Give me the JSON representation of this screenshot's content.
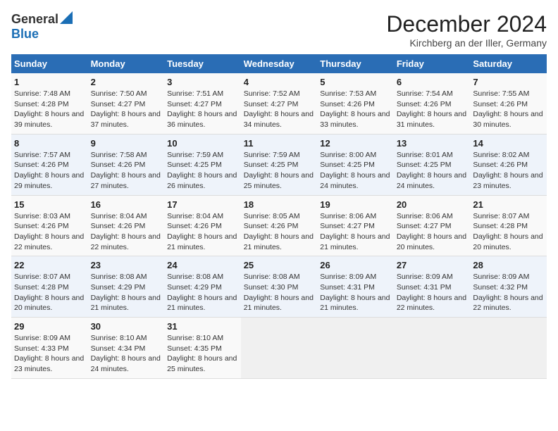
{
  "header": {
    "logo_general": "General",
    "logo_blue": "Blue",
    "month_title": "December 2024",
    "location": "Kirchberg an der Iller, Germany"
  },
  "weekdays": [
    "Sunday",
    "Monday",
    "Tuesday",
    "Wednesday",
    "Thursday",
    "Friday",
    "Saturday"
  ],
  "weeks": [
    [
      {
        "day": "1",
        "sunrise": "Sunrise: 7:48 AM",
        "sunset": "Sunset: 4:28 PM",
        "daylight": "Daylight: 8 hours and 39 minutes."
      },
      {
        "day": "2",
        "sunrise": "Sunrise: 7:50 AM",
        "sunset": "Sunset: 4:27 PM",
        "daylight": "Daylight: 8 hours and 37 minutes."
      },
      {
        "day": "3",
        "sunrise": "Sunrise: 7:51 AM",
        "sunset": "Sunset: 4:27 PM",
        "daylight": "Daylight: 8 hours and 36 minutes."
      },
      {
        "day": "4",
        "sunrise": "Sunrise: 7:52 AM",
        "sunset": "Sunset: 4:27 PM",
        "daylight": "Daylight: 8 hours and 34 minutes."
      },
      {
        "day": "5",
        "sunrise": "Sunrise: 7:53 AM",
        "sunset": "Sunset: 4:26 PM",
        "daylight": "Daylight: 8 hours and 33 minutes."
      },
      {
        "day": "6",
        "sunrise": "Sunrise: 7:54 AM",
        "sunset": "Sunset: 4:26 PM",
        "daylight": "Daylight: 8 hours and 31 minutes."
      },
      {
        "day": "7",
        "sunrise": "Sunrise: 7:55 AM",
        "sunset": "Sunset: 4:26 PM",
        "daylight": "Daylight: 8 hours and 30 minutes."
      }
    ],
    [
      {
        "day": "8",
        "sunrise": "Sunrise: 7:57 AM",
        "sunset": "Sunset: 4:26 PM",
        "daylight": "Daylight: 8 hours and 29 minutes."
      },
      {
        "day": "9",
        "sunrise": "Sunrise: 7:58 AM",
        "sunset": "Sunset: 4:26 PM",
        "daylight": "Daylight: 8 hours and 27 minutes."
      },
      {
        "day": "10",
        "sunrise": "Sunrise: 7:59 AM",
        "sunset": "Sunset: 4:25 PM",
        "daylight": "Daylight: 8 hours and 26 minutes."
      },
      {
        "day": "11",
        "sunrise": "Sunrise: 7:59 AM",
        "sunset": "Sunset: 4:25 PM",
        "daylight": "Daylight: 8 hours and 25 minutes."
      },
      {
        "day": "12",
        "sunrise": "Sunrise: 8:00 AM",
        "sunset": "Sunset: 4:25 PM",
        "daylight": "Daylight: 8 hours and 24 minutes."
      },
      {
        "day": "13",
        "sunrise": "Sunrise: 8:01 AM",
        "sunset": "Sunset: 4:25 PM",
        "daylight": "Daylight: 8 hours and 24 minutes."
      },
      {
        "day": "14",
        "sunrise": "Sunrise: 8:02 AM",
        "sunset": "Sunset: 4:26 PM",
        "daylight": "Daylight: 8 hours and 23 minutes."
      }
    ],
    [
      {
        "day": "15",
        "sunrise": "Sunrise: 8:03 AM",
        "sunset": "Sunset: 4:26 PM",
        "daylight": "Daylight: 8 hours and 22 minutes."
      },
      {
        "day": "16",
        "sunrise": "Sunrise: 8:04 AM",
        "sunset": "Sunset: 4:26 PM",
        "daylight": "Daylight: 8 hours and 22 minutes."
      },
      {
        "day": "17",
        "sunrise": "Sunrise: 8:04 AM",
        "sunset": "Sunset: 4:26 PM",
        "daylight": "Daylight: 8 hours and 21 minutes."
      },
      {
        "day": "18",
        "sunrise": "Sunrise: 8:05 AM",
        "sunset": "Sunset: 4:26 PM",
        "daylight": "Daylight: 8 hours and 21 minutes."
      },
      {
        "day": "19",
        "sunrise": "Sunrise: 8:06 AM",
        "sunset": "Sunset: 4:27 PM",
        "daylight": "Daylight: 8 hours and 21 minutes."
      },
      {
        "day": "20",
        "sunrise": "Sunrise: 8:06 AM",
        "sunset": "Sunset: 4:27 PM",
        "daylight": "Daylight: 8 hours and 20 minutes."
      },
      {
        "day": "21",
        "sunrise": "Sunrise: 8:07 AM",
        "sunset": "Sunset: 4:28 PM",
        "daylight": "Daylight: 8 hours and 20 minutes."
      }
    ],
    [
      {
        "day": "22",
        "sunrise": "Sunrise: 8:07 AM",
        "sunset": "Sunset: 4:28 PM",
        "daylight": "Daylight: 8 hours and 20 minutes."
      },
      {
        "day": "23",
        "sunrise": "Sunrise: 8:08 AM",
        "sunset": "Sunset: 4:29 PM",
        "daylight": "Daylight: 8 hours and 21 minutes."
      },
      {
        "day": "24",
        "sunrise": "Sunrise: 8:08 AM",
        "sunset": "Sunset: 4:29 PM",
        "daylight": "Daylight: 8 hours and 21 minutes."
      },
      {
        "day": "25",
        "sunrise": "Sunrise: 8:08 AM",
        "sunset": "Sunset: 4:30 PM",
        "daylight": "Daylight: 8 hours and 21 minutes."
      },
      {
        "day": "26",
        "sunrise": "Sunrise: 8:09 AM",
        "sunset": "Sunset: 4:31 PM",
        "daylight": "Daylight: 8 hours and 21 minutes."
      },
      {
        "day": "27",
        "sunrise": "Sunrise: 8:09 AM",
        "sunset": "Sunset: 4:31 PM",
        "daylight": "Daylight: 8 hours and 22 minutes."
      },
      {
        "day": "28",
        "sunrise": "Sunrise: 8:09 AM",
        "sunset": "Sunset: 4:32 PM",
        "daylight": "Daylight: 8 hours and 22 minutes."
      }
    ],
    [
      {
        "day": "29",
        "sunrise": "Sunrise: 8:09 AM",
        "sunset": "Sunset: 4:33 PM",
        "daylight": "Daylight: 8 hours and 23 minutes."
      },
      {
        "day": "30",
        "sunrise": "Sunrise: 8:10 AM",
        "sunset": "Sunset: 4:34 PM",
        "daylight": "Daylight: 8 hours and 24 minutes."
      },
      {
        "day": "31",
        "sunrise": "Sunrise: 8:10 AM",
        "sunset": "Sunset: 4:35 PM",
        "daylight": "Daylight: 8 hours and 25 minutes."
      },
      null,
      null,
      null,
      null
    ]
  ]
}
